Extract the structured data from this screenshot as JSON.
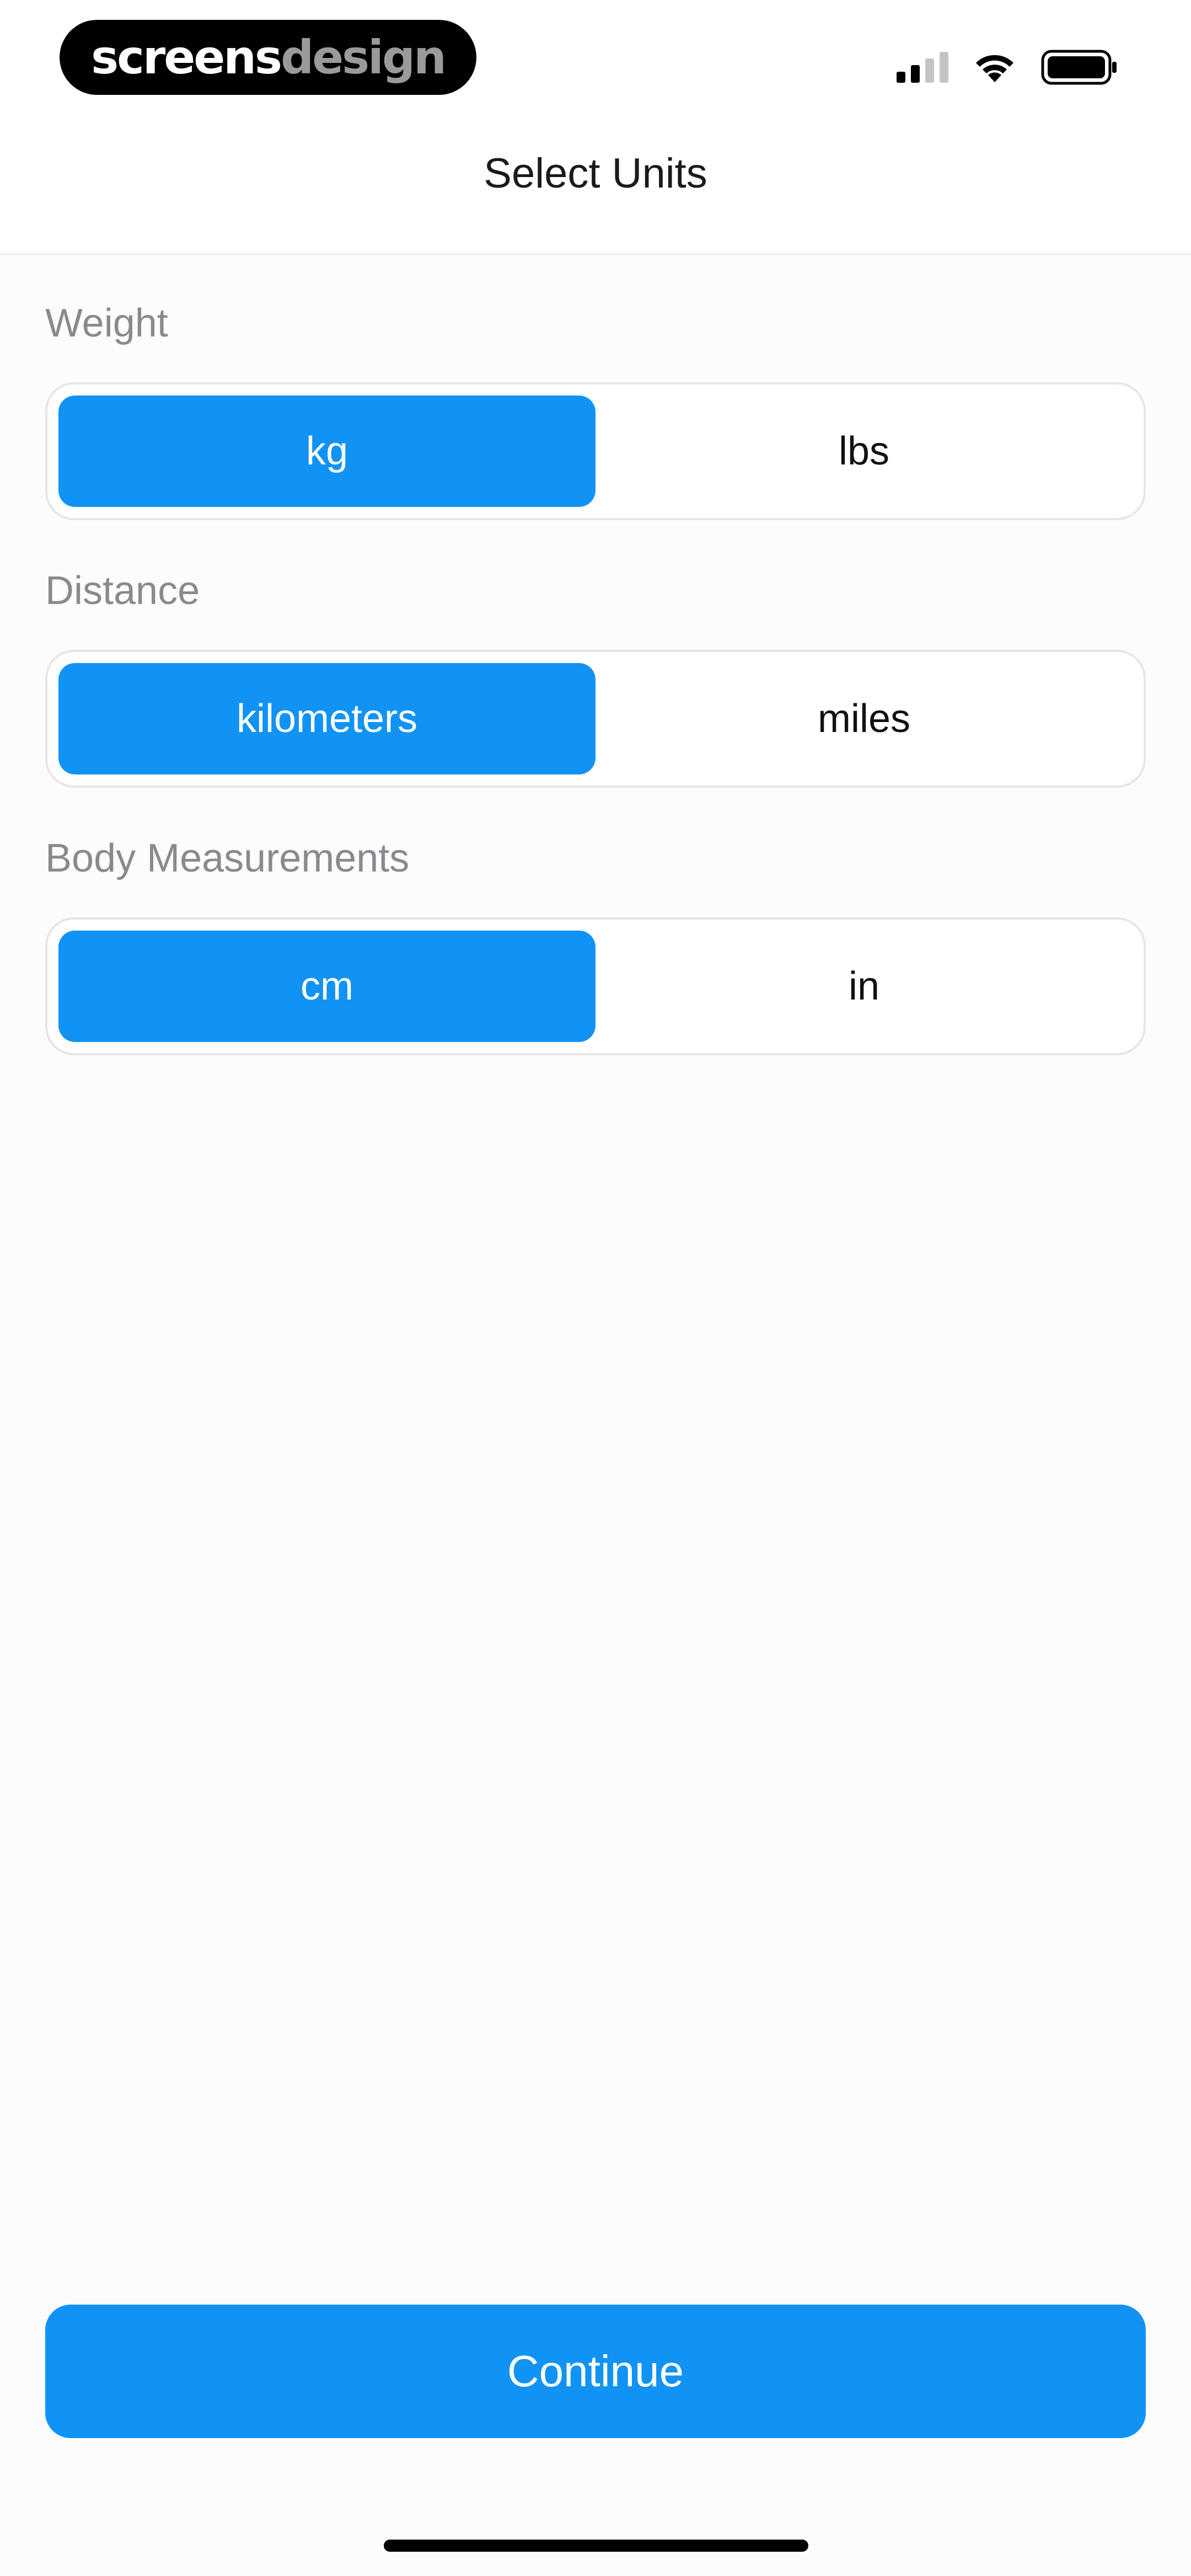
{
  "status_bar": {
    "brand_part1": "screens",
    "brand_part2": "design",
    "signal_icon": "cellular-signal-icon",
    "wifi_icon": "wifi-icon",
    "battery_icon": "battery-icon",
    "signal_bars_active": 2,
    "signal_bars_total": 4
  },
  "header": {
    "title": "Select Units"
  },
  "sections": [
    {
      "label": "Weight",
      "options": [
        "kg",
        "lbs"
      ],
      "selected": "kg"
    },
    {
      "label": "Distance",
      "options": [
        "kilometers",
        "miles"
      ],
      "selected": "kilometers"
    },
    {
      "label": "Body Measurements",
      "options": [
        "cm",
        "in"
      ],
      "selected": "cm"
    }
  ],
  "footer": {
    "continue_label": "Continue"
  },
  "colors": {
    "accent": "#1093f5",
    "label_gray": "#8a8a8e",
    "text": "#111111",
    "background": "#fcfcfc"
  }
}
